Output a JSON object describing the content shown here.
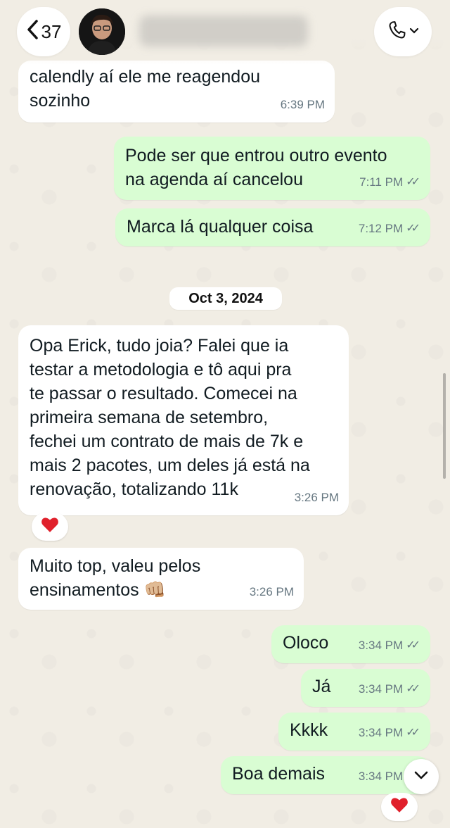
{
  "header": {
    "back_count": "37",
    "back_icon": "chevron-left-icon",
    "call_icon": "phone-icon"
  },
  "date_separator": "Oct 3, 2024",
  "messages": [
    {
      "dir": "in",
      "text": "calendly aí ele me reagendou\nsozinho",
      "time": "6:39 PM"
    },
    {
      "dir": "out",
      "text": "Pode ser que entrou outro evento\nna agenda aí cancelou",
      "time": "7:11 PM",
      "read": true
    },
    {
      "dir": "out",
      "text": "Marca lá qualquer coisa",
      "time": "7:12 PM",
      "read": true
    },
    {
      "dir": "in",
      "text": "Opa Erick, tudo joia? Falei que ia\ntestar a metodologia e tô aqui pra\nte passar o resultado. Comecei na\nprimeira semana de setembro,\nfechei um contrato de mais de 7k e\nmais 2 pacotes, um deles já está na\nrenovação, totalizando 11k",
      "time": "3:26 PM",
      "reaction": "❤️"
    },
    {
      "dir": "in",
      "text": "Muito top, valeu pelos\nensinamentos 👊🏼",
      "time": "3:26 PM"
    },
    {
      "dir": "out",
      "text": "Oloco",
      "time": "3:34 PM",
      "read": true
    },
    {
      "dir": "out",
      "text": "Já",
      "time": "3:34 PM",
      "read": true
    },
    {
      "dir": "out",
      "text": "Kkkk",
      "time": "3:34 PM",
      "read": true
    },
    {
      "dir": "out",
      "text": "Boa demais",
      "time": "3:34 PM",
      "read": true,
      "reaction": "❤️"
    }
  ],
  "colors": {
    "incoming_bubble": "#ffffff",
    "outgoing_bubble": "#d9fdd3",
    "background": "#efeae2",
    "reaction_heart": "#e0202b"
  }
}
